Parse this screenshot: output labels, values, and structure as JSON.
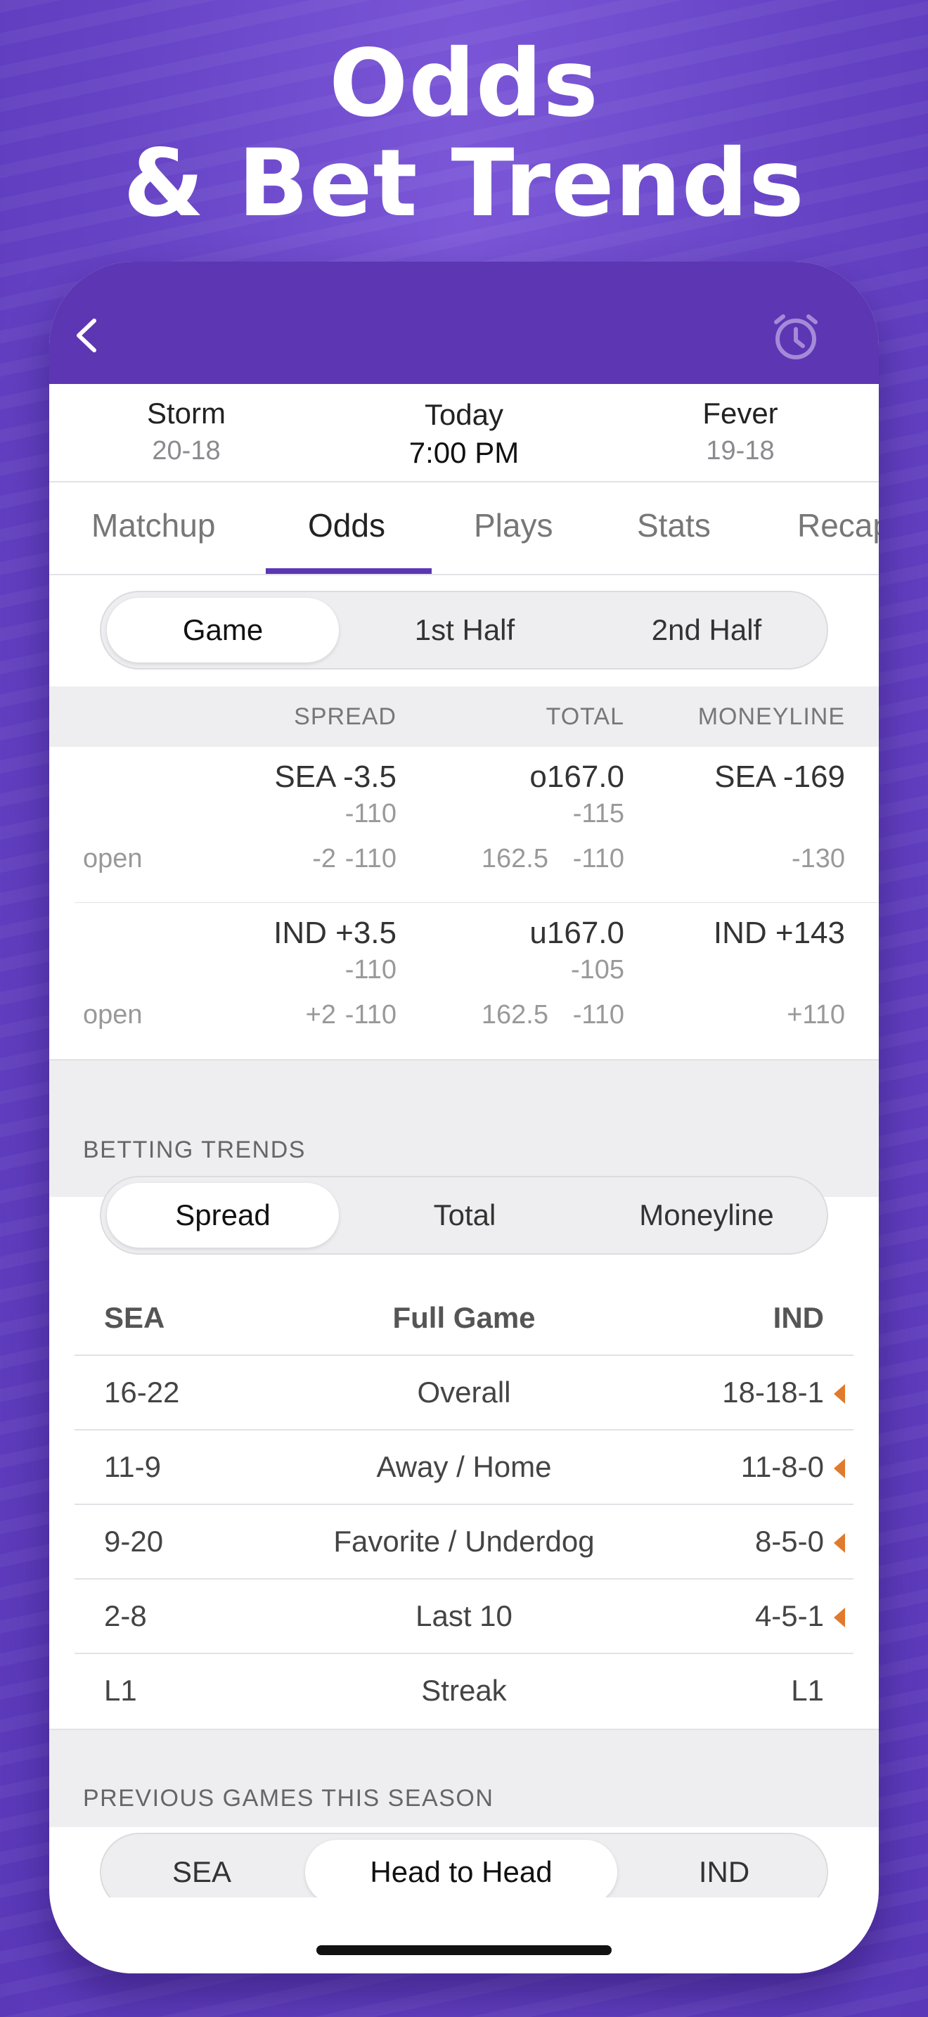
{
  "headline": {
    "line1": "Odds",
    "line2": "& Bet Trends"
  },
  "nav": {
    "back_icon": "chevron-left-icon",
    "alarm_icon": "alarm-clock-icon",
    "bar_color": "#5d36b4"
  },
  "game": {
    "away": {
      "name": "Storm",
      "record": "20-18"
    },
    "home": {
      "name": "Fever",
      "record": "19-18"
    },
    "day": "Today",
    "time": "7:00 PM"
  },
  "tabs": [
    "Matchup",
    "Odds",
    "Plays",
    "Stats",
    "Recap"
  ],
  "active_tab": "Odds",
  "period_segments": [
    "Game",
    "1st Half",
    "2nd Half"
  ],
  "period_selected": "Game",
  "odds": {
    "headers": {
      "spread": "SPREAD",
      "total": "TOTAL",
      "moneyline": "MONEYLINE"
    },
    "open_label": "open",
    "rows": [
      {
        "spread": "SEA -3.5",
        "spread_price": "-110",
        "total": "o167.0",
        "total_price": "-115",
        "moneyline": "SEA -169",
        "open_spread": "-2",
        "open_spread_price": "-110",
        "open_total": "162.5",
        "open_total_price": "-110",
        "open_moneyline": "-130"
      },
      {
        "spread": "IND +3.5",
        "spread_price": "-110",
        "total": "u167.0",
        "total_price": "-105",
        "moneyline": "IND +143",
        "open_spread": "+2",
        "open_spread_price": "-110",
        "open_total": "162.5",
        "open_total_price": "-110",
        "open_moneyline": "+110"
      }
    ]
  },
  "betting_trends": {
    "title": "BETTING TRENDS",
    "segments": [
      "Spread",
      "Total",
      "Moneyline"
    ],
    "selected": "Spread",
    "header": {
      "left": "SEA",
      "center": "Full Game",
      "right": "IND"
    },
    "rows": [
      {
        "left": "16-22",
        "label": "Overall",
        "right": "18-18-1",
        "edge": true
      },
      {
        "left": "11-9",
        "label": "Away / Home",
        "right": "11-8-0",
        "edge": true
      },
      {
        "left": "9-20",
        "label": "Favorite / Underdog",
        "right": "8-5-0",
        "edge": true
      },
      {
        "left": "2-8",
        "label": "Last 10",
        "right": "4-5-1",
        "edge": true
      },
      {
        "left": "L1",
        "label": "Streak",
        "right": "L1",
        "edge": false
      }
    ],
    "edge_color": "#e07a2c"
  },
  "previous_games": {
    "title": "PREVIOUS GAMES THIS SEASON",
    "segments": [
      "SEA",
      "Head to Head",
      "IND"
    ],
    "selected": "Head to Head"
  }
}
